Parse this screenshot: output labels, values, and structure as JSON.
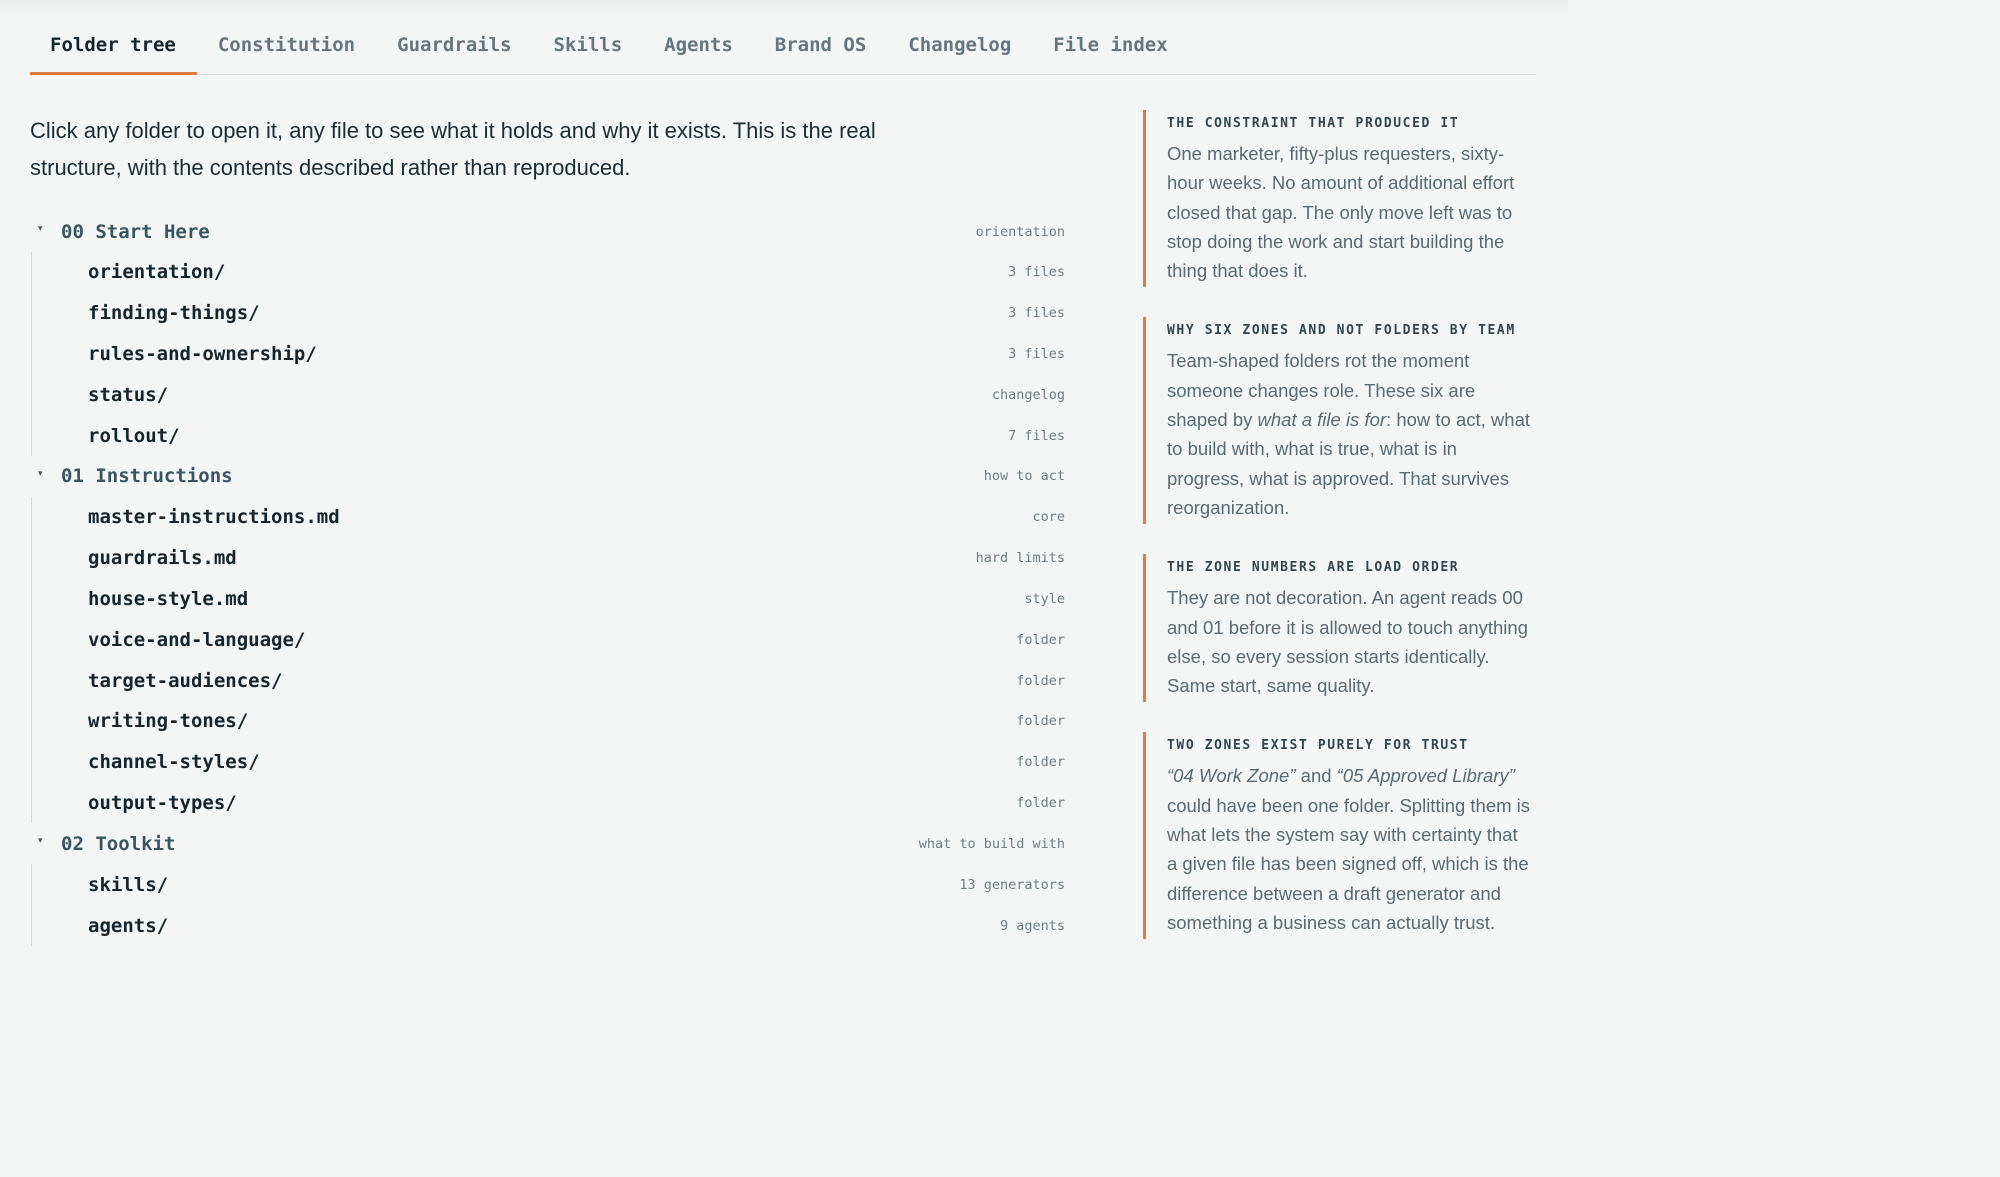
{
  "tabs": [
    {
      "label": "Folder tree",
      "active": true
    },
    {
      "label": "Constitution",
      "active": false
    },
    {
      "label": "Guardrails",
      "active": false
    },
    {
      "label": "Skills",
      "active": false
    },
    {
      "label": "Agents",
      "active": false
    },
    {
      "label": "Brand OS",
      "active": false
    },
    {
      "label": "Changelog",
      "active": false
    },
    {
      "label": "File index",
      "active": false
    }
  ],
  "intro": "Click any folder to open it, any file to see what it holds and why it exists. This is the real structure, with the contents described rather than reproduced.",
  "tree": [
    {
      "name": "00 Start Here",
      "tag": "orientation",
      "expanded": true,
      "children": [
        {
          "name": "orientation/",
          "tag": "3 files"
        },
        {
          "name": "finding-things/",
          "tag": "3 files"
        },
        {
          "name": "rules-and-ownership/",
          "tag": "3 files"
        },
        {
          "name": "status/",
          "tag": "changelog"
        },
        {
          "name": "rollout/",
          "tag": "7 files"
        }
      ]
    },
    {
      "name": "01 Instructions",
      "tag": "how to act",
      "expanded": true,
      "children": [
        {
          "name": "master-instructions.md",
          "tag": "core"
        },
        {
          "name": "guardrails.md",
          "tag": "hard limits"
        },
        {
          "name": "house-style.md",
          "tag": "style"
        },
        {
          "name": "voice-and-language/",
          "tag": "folder"
        },
        {
          "name": "target-audiences/",
          "tag": "folder"
        },
        {
          "name": "writing-tones/",
          "tag": "folder"
        },
        {
          "name": "channel-styles/",
          "tag": "folder"
        },
        {
          "name": "output-types/",
          "tag": "folder"
        }
      ]
    },
    {
      "name": "02 Toolkit",
      "tag": "what to build with",
      "expanded": true,
      "children": [
        {
          "name": "skills/",
          "tag": "13 generators"
        },
        {
          "name": "agents/",
          "tag": "9 agents"
        }
      ]
    }
  ],
  "notes": [
    {
      "title": "THE CONSTRAINT THAT PRODUCED IT",
      "segments": [
        {
          "text": "One marketer, fifty-plus requesters, sixty-hour weeks. No amount of additional effort closed that gap. The only move left was to stop doing the work and start building the thing that does it.",
          "italic": false
        }
      ]
    },
    {
      "title": "WHY SIX ZONES AND NOT FOLDERS BY TEAM",
      "segments": [
        {
          "text": "Team-shaped folders rot the moment someone changes role. These six are shaped by ",
          "italic": false
        },
        {
          "text": "what a file is for",
          "italic": true
        },
        {
          "text": ": how to act, what to build with, what is true, what is in progress, what is approved. That survives reorganization.",
          "italic": false
        }
      ]
    },
    {
      "title": "THE ZONE NUMBERS ARE LOAD ORDER",
      "segments": [
        {
          "text": "They are not decoration. An agent reads 00 and 01 before it is allowed to touch anything else, so every session starts identically. Same start, same quality.",
          "italic": false
        }
      ]
    },
    {
      "title": "TWO ZONES EXIST PURELY FOR TRUST",
      "segments": [
        {
          "text": "“04 Work Zone”",
          "italic": true
        },
        {
          "text": " and ",
          "italic": false
        },
        {
          "text": "“05 Approved Library”",
          "italic": true
        },
        {
          "text": " could have been one folder. Splitting them is what lets the system say with certainty that a given file has been signed off, which is the difference between a draft generator and something a business can actually trust.",
          "italic": false
        }
      ]
    }
  ]
}
